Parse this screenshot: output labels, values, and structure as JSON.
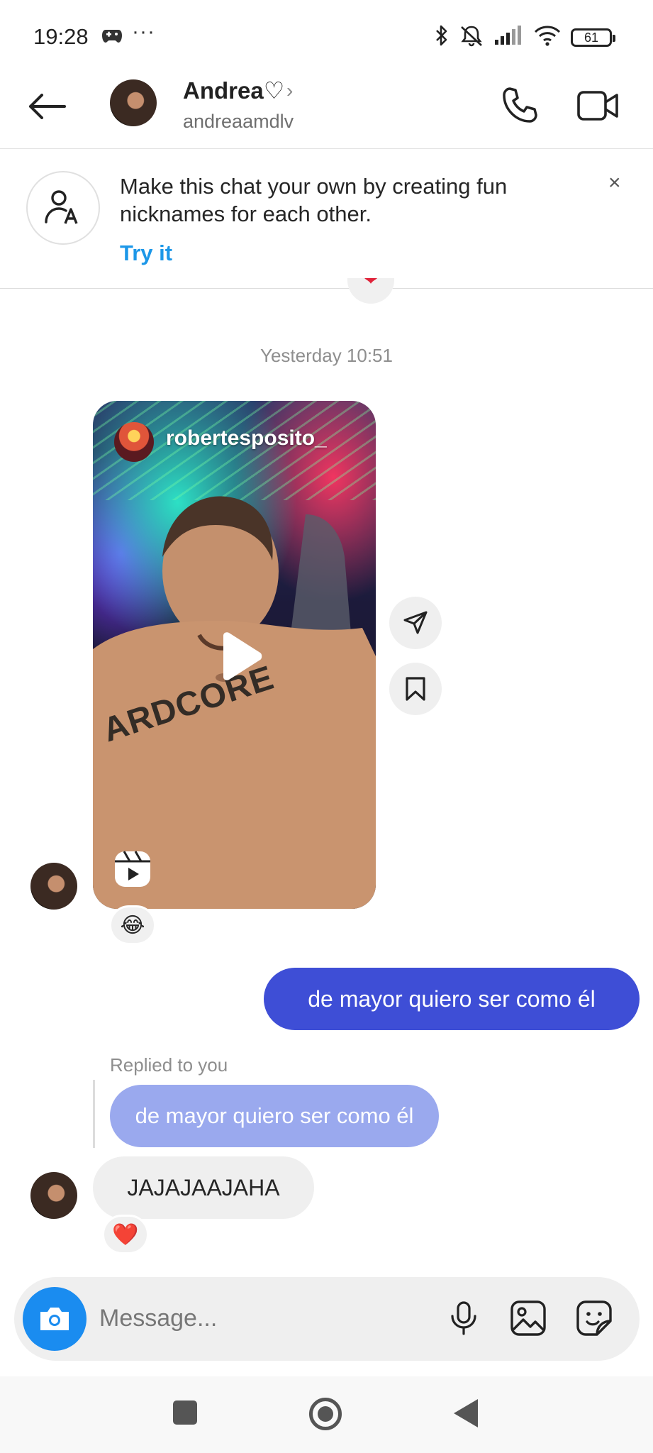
{
  "status_bar": {
    "time": "19:28",
    "dots": "···",
    "battery": "61",
    "icons": [
      "gamepad-icon",
      "bluetooth-icon",
      "mute-icon",
      "signal-icon",
      "wifi-icon",
      "battery-icon"
    ]
  },
  "header": {
    "contact_name": "Andrea♡",
    "contact_username": "andreaamdlv",
    "chevron": "›",
    "icons": [
      "back-arrow-icon",
      "phone-icon",
      "video-camera-icon"
    ]
  },
  "banner": {
    "text": "Make this chat your own by creating fun nicknames for each other.",
    "action": "Try it",
    "close": "×"
  },
  "conversation": {
    "timestamp": "Yesterday 10:51",
    "top_reaction": "❤",
    "reel": {
      "owner": "robertesposito_",
      "tattoo_text": "ARDCORE",
      "reaction": "😂"
    },
    "sent_message": "de mayor quiero ser como él",
    "reply_label": "Replied to you",
    "reply_quote": "de mayor quiero ser como él",
    "received_message": "JAJAJAAJAHA",
    "received_reaction": "❤️"
  },
  "composer": {
    "placeholder": "Message..."
  },
  "colors": {
    "sent_bubble": "#3e4ed6",
    "reply_quote": "#9aa9ee",
    "link_blue": "#1c97e8",
    "camera_button": "#1a8cf0"
  }
}
